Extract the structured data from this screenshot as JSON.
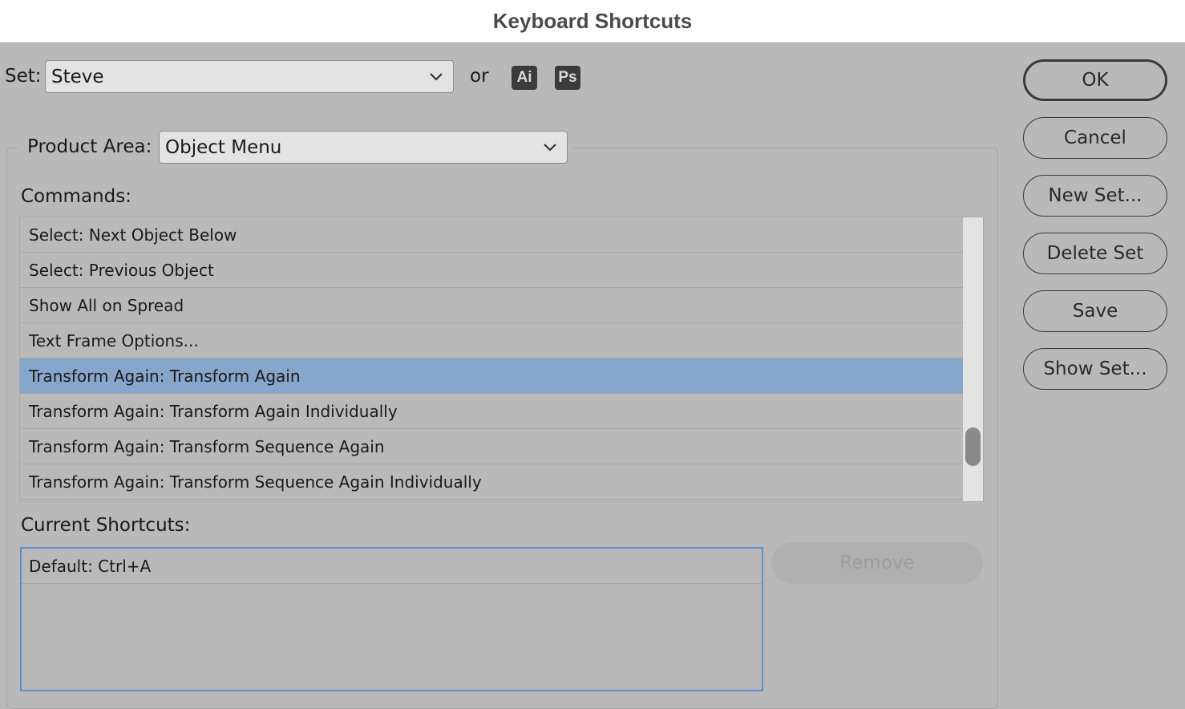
{
  "window": {
    "title": "Keyboard Shortcuts"
  },
  "set": {
    "label": "Set:",
    "value": "Steve",
    "or_label": "or",
    "ai_badge": "Ai",
    "ps_badge": "Ps"
  },
  "product_area": {
    "label": "Product Area:",
    "value": "Object Menu"
  },
  "commands": {
    "label": "Commands:",
    "items": [
      {
        "label": "Select: Next Object Below",
        "selected": false
      },
      {
        "label": "Select: Previous Object",
        "selected": false
      },
      {
        "label": "Show All on Spread",
        "selected": false
      },
      {
        "label": "Text Frame Options...",
        "selected": false
      },
      {
        "label": "Transform Again: Transform Again",
        "selected": true
      },
      {
        "label": "Transform Again: Transform Again Individually",
        "selected": false
      },
      {
        "label": "Transform Again: Transform Sequence Again",
        "selected": false
      },
      {
        "label": "Transform Again: Transform Sequence Again Individually",
        "selected": false
      }
    ]
  },
  "current_shortcuts": {
    "label": "Current Shortcuts:",
    "items": [
      "Default: Ctrl+A"
    ],
    "remove_label": "Remove"
  },
  "buttons": {
    "ok": "OK",
    "cancel": "Cancel",
    "new_set": "New Set...",
    "delete_set": "Delete Set",
    "save": "Save",
    "show_set": "Show Set..."
  },
  "colors": {
    "background": "#b9b9b9",
    "selection": "#87a6cc",
    "focus_border": "#5f8fd0"
  },
  "icons": {
    "dropdown": "chevron-down-icon"
  }
}
